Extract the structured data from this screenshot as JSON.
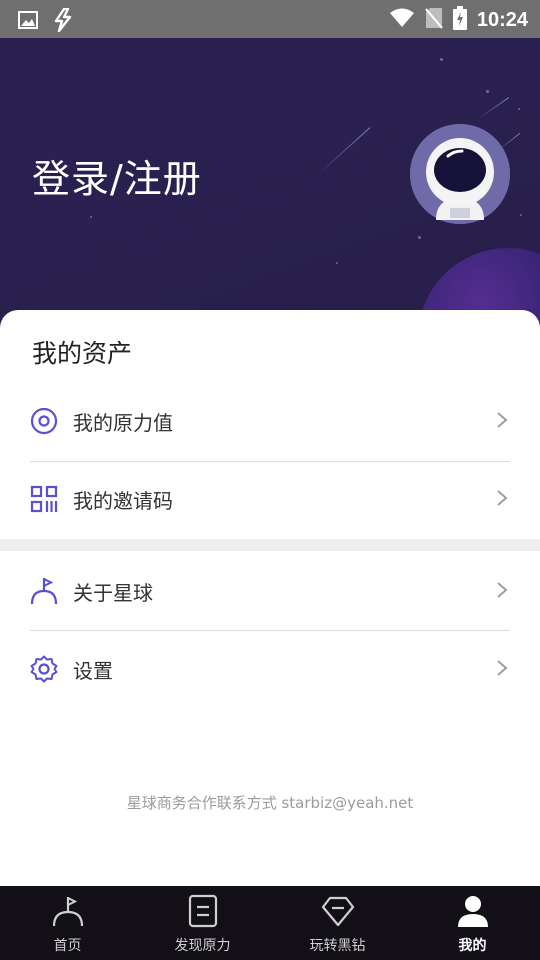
{
  "status_bar": {
    "time": "10:24",
    "icons": [
      "image-icon",
      "bolt-icon",
      "wifi-icon",
      "sim-off-icon",
      "battery-charging-icon"
    ]
  },
  "header": {
    "login_label": "登录/注册",
    "avatar_icon": "astronaut-avatar"
  },
  "assets": {
    "title": "我的资产",
    "items": [
      {
        "label": "我的原力值",
        "icon": "force-value-icon"
      },
      {
        "label": "我的邀请码",
        "icon": "qr-code-icon"
      }
    ]
  },
  "more": {
    "items": [
      {
        "label": "关于星球",
        "icon": "flag-person-icon"
      },
      {
        "label": "设置",
        "icon": "gear-icon"
      }
    ]
  },
  "footer": {
    "contact": "星球商务合作联系方式 starbiz@yeah.net"
  },
  "bottom_nav": {
    "items": [
      {
        "label": "首页",
        "icon": "home-flag-icon"
      },
      {
        "label": "发现原力",
        "icon": "document-icon"
      },
      {
        "label": "玩转黑钻",
        "icon": "diamond-icon"
      },
      {
        "label": "我的",
        "icon": "profile-icon"
      }
    ],
    "active_index": 3
  },
  "colors": {
    "accent": "#5b4fd6",
    "hero_bg": "#2a2150",
    "nav_bg": "#120f16"
  }
}
